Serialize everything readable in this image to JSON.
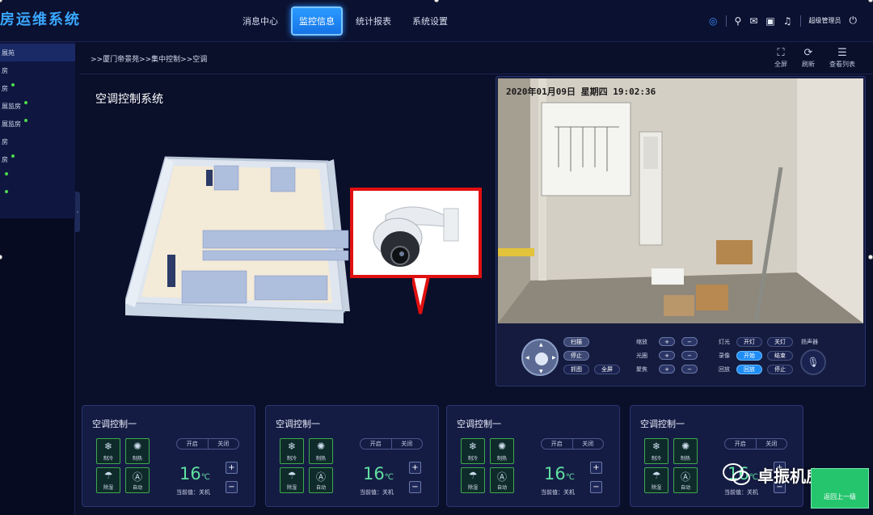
{
  "app": {
    "title": "房运维系统"
  },
  "nav": {
    "items": [
      "消息中心",
      "监控信息",
      "统计报表",
      "系统设置"
    ],
    "active_index": 1
  },
  "header": {
    "admin_label": "超级管理员",
    "icons": [
      "signal-icon",
      "network-icon",
      "message-icon",
      "monitor-icon",
      "speaker-icon",
      "power-icon"
    ]
  },
  "sidebar": {
    "items": [
      {
        "label": "展苑",
        "dot": false,
        "selected": true
      },
      {
        "label": "房",
        "dot": false
      },
      {
        "label": "房",
        "dot": true
      },
      {
        "label": "展监房",
        "dot": true
      },
      {
        "label": "展监房",
        "dot": true
      },
      {
        "label": "房",
        "dot": false
      },
      {
        "label": "房",
        "dot": true
      },
      {
        "label": "",
        "dot": true
      },
      {
        "label": "",
        "dot": true
      }
    ]
  },
  "breadcrumb": {
    "text": ">>厦门帝景苑>>集中控制>>空调"
  },
  "tools": [
    {
      "label": "全屏",
      "icon": "fullscreen-icon",
      "glyph": "⛶"
    },
    {
      "label": "刷新",
      "icon": "refresh-icon",
      "glyph": "⟳"
    },
    {
      "label": "查看列表",
      "icon": "list-icon",
      "glyph": "☰"
    }
  ],
  "main": {
    "title": "空调控制系统"
  },
  "video": {
    "osd": "2020年01月09日 星期四 19:02:36"
  },
  "ptz": {
    "scan": "扫描",
    "stop": "停止",
    "snapshot": "抓图",
    "fullscreen": "全屏",
    "zoom": "缩放",
    "iris": "光圈",
    "focus": "聚焦",
    "light": "灯光",
    "light_on": "开灯",
    "light_off": "关灯",
    "record": "录像",
    "record_start": "开始",
    "record_end": "结束",
    "playback": "回放",
    "playback_btn": "回放",
    "playback_stop": "停止",
    "speaker": "扬声器"
  },
  "ac_cards": [
    {
      "title": "空调控制一",
      "modes": [
        "制冷",
        "制热",
        "除湿",
        "自动"
      ],
      "on": "开启",
      "off": "关闭",
      "temp": "16",
      "unit": "℃",
      "current": "当前值：关机"
    },
    {
      "title": "空调控制一",
      "modes": [
        "制冷",
        "制热",
        "除湿",
        "自动"
      ],
      "on": "开启",
      "off": "关闭",
      "temp": "16",
      "unit": "℃",
      "current": "当前值：关机"
    },
    {
      "title": "空调控制一",
      "modes": [
        "制冷",
        "制热",
        "除湿",
        "自动"
      ],
      "on": "开启",
      "off": "关闭",
      "temp": "16",
      "unit": "℃",
      "current": "当前值：关机"
    },
    {
      "title": "空调控制一",
      "modes": [
        "制冷",
        "制热",
        "除湿",
        "自动"
      ],
      "on": "开启",
      "off": "关闭",
      "temp": "16",
      "unit": "℃",
      "current": "当前值：关机"
    }
  ],
  "back": {
    "label": "返回上一级"
  },
  "watermark": {
    "text": "卓振机房"
  },
  "colors": {
    "accent": "#1e8cf5",
    "temp": "#5fe0a0",
    "mode_border": "#3ea94e",
    "callout": "#e01010",
    "back": "#25c56e"
  }
}
